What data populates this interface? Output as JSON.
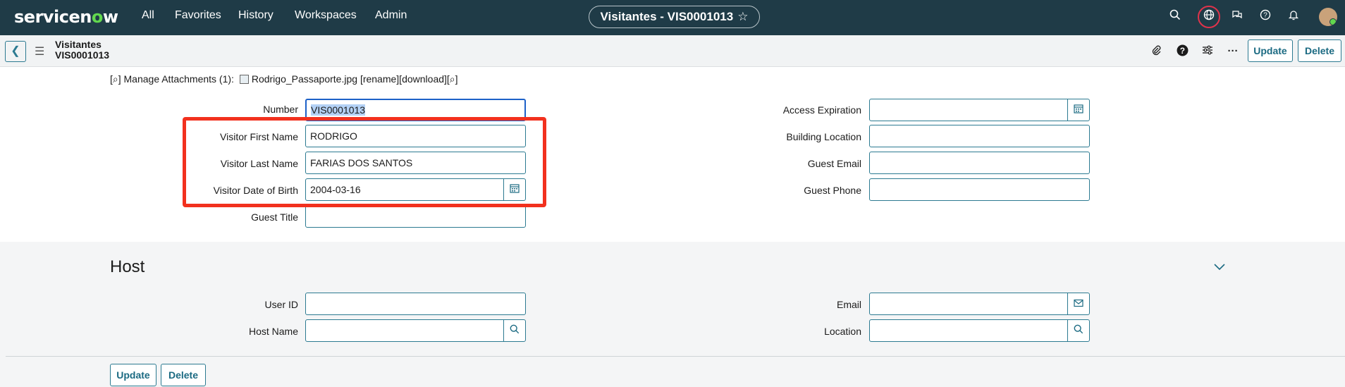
{
  "topbar": {
    "logo_prefix": "servicen",
    "logo_o": "o",
    "logo_suffix": "w",
    "nav": [
      "All",
      "Favorites",
      "History",
      "Workspaces",
      "Admin"
    ],
    "record_pill": "Visitantes - VIS0001013",
    "star_icon": "☆"
  },
  "header": {
    "table_name": "Visitantes",
    "record_number": "VIS0001013",
    "update_label": "Update",
    "delete_label": "Delete"
  },
  "attachments": {
    "prefix": "[⌕] Manage Attachments (1):",
    "filename": "Rodrigo_Passaporte.jpg",
    "actions": "[rename][download][⌕]"
  },
  "form": {
    "left": [
      {
        "label": "Number",
        "value": "VIS0001013"
      },
      {
        "label": "Visitor First Name",
        "value": "RODRIGO"
      },
      {
        "label": "Visitor Last Name",
        "value": "FARIAS DOS SANTOS"
      },
      {
        "label": "Visitor Date of Birth",
        "value": "2004-03-16"
      },
      {
        "label": "Guest Title",
        "value": ""
      }
    ],
    "right": [
      {
        "label": "Access Expiration",
        "value": ""
      },
      {
        "label": "Building Location",
        "value": ""
      },
      {
        "label": "Guest Email",
        "value": ""
      },
      {
        "label": "Guest Phone",
        "value": ""
      }
    ]
  },
  "host": {
    "title": "Host",
    "fields": [
      {
        "label": "User ID",
        "value": ""
      },
      {
        "label": "Host Name",
        "value": ""
      },
      {
        "label": "Email",
        "value": ""
      },
      {
        "label": "Location",
        "value": ""
      }
    ]
  },
  "footer": {
    "update_label": "Update",
    "delete_label": "Delete"
  },
  "colors": {
    "topbar_bg": "#1f3b47",
    "accent": "#2c7a91",
    "highlight_box": "#f2311e"
  }
}
